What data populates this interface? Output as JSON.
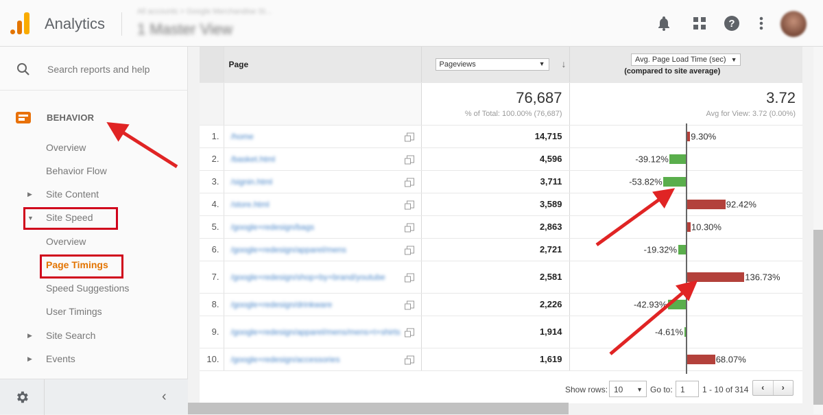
{
  "header": {
    "app_title": "Analytics",
    "breadcrumb": "All accounts > Google Merchandise St...",
    "view_name": "1 Master View",
    "icons": [
      "bell-icon",
      "apps-grid-icon",
      "help-icon",
      "more-vert-icon",
      "avatar"
    ]
  },
  "sidebar": {
    "search_placeholder": "Search reports and help",
    "section": "BEHAVIOR",
    "items": [
      {
        "label": "Overview",
        "level": 1
      },
      {
        "label": "Behavior Flow",
        "level": 1
      },
      {
        "label": "Site Content",
        "level": 1,
        "expandable": true,
        "expanded": false
      },
      {
        "label": "Site Speed",
        "level": 1,
        "expandable": true,
        "expanded": true
      },
      {
        "label": "Overview",
        "level": 2
      },
      {
        "label": "Page Timings",
        "level": 2,
        "active": true
      },
      {
        "label": "Speed Suggestions",
        "level": 2
      },
      {
        "label": "User Timings",
        "level": 2
      },
      {
        "label": "Site Search",
        "level": 1,
        "expandable": true,
        "expanded": false
      },
      {
        "label": "Events",
        "level": 1,
        "expandable": true,
        "expanded": false
      }
    ]
  },
  "table": {
    "col_page": "Page",
    "col_metric1": "Pageviews",
    "col_metric2": "Avg. Page Load Time (sec)",
    "col_metric2_sub": "(compared to site average)",
    "total_pageviews": "76,687",
    "total_pageviews_sub": "% of Total: 100.00% (76,687)",
    "total_loadtime": "3.72",
    "total_loadtime_sub": "Avg for View: 3.72 (0.00%)",
    "rows": [
      {
        "idx": "1.",
        "page": "/home",
        "pageviews": "14,715",
        "delta": 9.3,
        "delta_label": "9.30%"
      },
      {
        "idx": "2.",
        "page": "/basket.html",
        "pageviews": "4,596",
        "delta": -39.12,
        "delta_label": "-39.12%"
      },
      {
        "idx": "3.",
        "page": "/signin.html",
        "pageviews": "3,711",
        "delta": -53.82,
        "delta_label": "-53.82%"
      },
      {
        "idx": "4.",
        "page": "/store.html",
        "pageviews": "3,589",
        "delta": 92.42,
        "delta_label": "92.42%"
      },
      {
        "idx": "5.",
        "page": "/google+redesign/bags",
        "pageviews": "2,863",
        "delta": 10.3,
        "delta_label": "10.30%"
      },
      {
        "idx": "6.",
        "page": "/google+redesign/apparel/mens",
        "pageviews": "2,721",
        "delta": -19.32,
        "delta_label": "-19.32%"
      },
      {
        "idx": "7.",
        "page": "/google+redesign/shop+by+brand/youtube",
        "pageviews": "2,581",
        "delta": 136.73,
        "delta_label": "136.73%"
      },
      {
        "idx": "8.",
        "page": "/google+redesign/drinkware",
        "pageviews": "2,226",
        "delta": -42.93,
        "delta_label": "-42.93%"
      },
      {
        "idx": "9.",
        "page": "/google+redesign/apparel/mens/mens+t+shirts",
        "pageviews": "1,914",
        "delta": -4.61,
        "delta_label": "-4.61%"
      },
      {
        "idx": "10.",
        "page": "/google+redesign/accessories",
        "pageviews": "1,619",
        "delta": 68.07,
        "delta_label": "68.07%"
      }
    ]
  },
  "footer": {
    "show_rows_label": "Show rows:",
    "show_rows_value": "10",
    "goto_label": "Go to:",
    "goto_value": "1",
    "range": "1 - 10 of 314",
    "prev": "‹",
    "next": "›"
  },
  "colors": {
    "positive_bar": "#b3413b",
    "negative_bar": "#5aae4c",
    "accent": "#e37400",
    "annotation": "#d0021b"
  }
}
